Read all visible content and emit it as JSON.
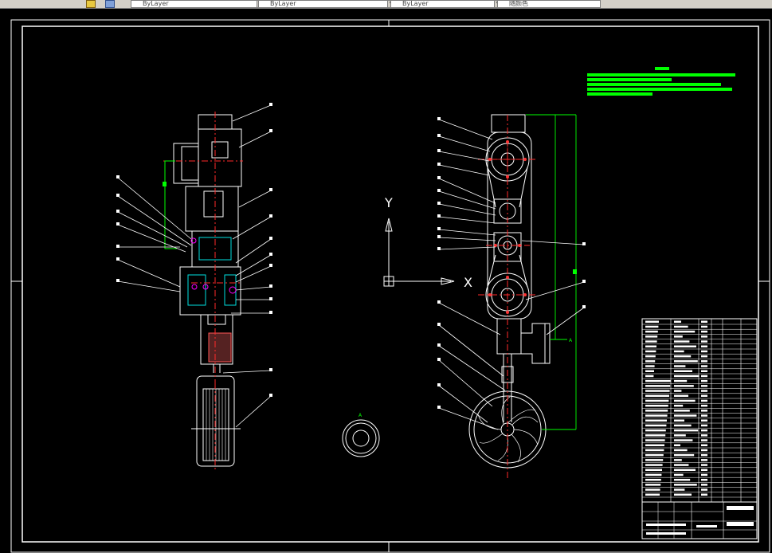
{
  "toolbar": {
    "combos": [
      {
        "value": "ByLayer"
      },
      {
        "value": "ByLayer"
      },
      {
        "value": "ByLayer"
      },
      {
        "value": "随颜色"
      }
    ]
  },
  "drawing": {
    "axis_y": "Y",
    "axis_x": "X",
    "mark_a": "A",
    "mark_a2": "A"
  },
  "colors": {
    "background": "#000000",
    "lines": "#ffffff",
    "centerline": "#ff2a2a",
    "dimension": "#00ff00",
    "hatch": "#00e0e0",
    "highlight": "#ff00ff"
  }
}
